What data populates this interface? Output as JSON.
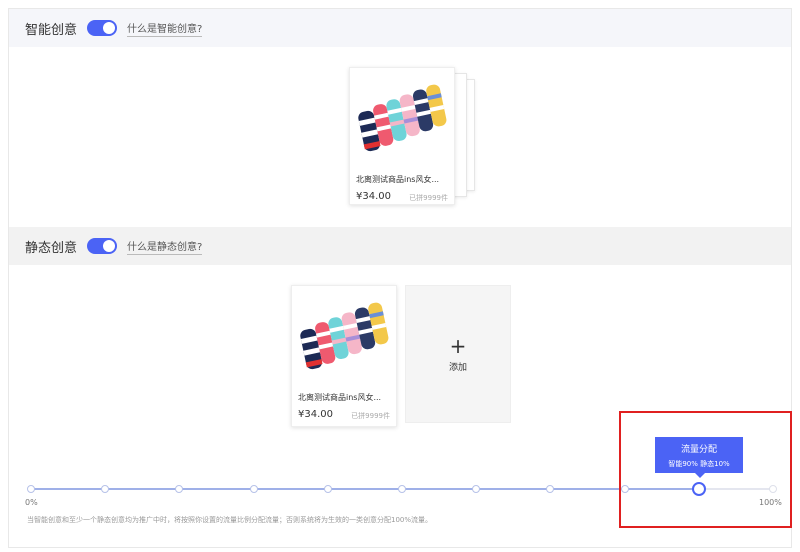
{
  "smart_section": {
    "title": "智能创意",
    "toggle_on": true,
    "help_link": "什么是智能创意?"
  },
  "static_section": {
    "title": "静态创意",
    "toggle_on": true,
    "help_link": "什么是静态创意?",
    "add_label": "添加",
    "add_icon": "+"
  },
  "product": {
    "title": "北离测试商品ins风女...",
    "price": "¥34.00",
    "sold": "已拼9999件"
  },
  "traffic": {
    "tooltip_title": "流量分配",
    "tooltip_detail": "智能90% 静态10%",
    "min_label": "0%",
    "max_label": "100%",
    "smart_percent": 90,
    "hint": "当智能创意和至少一个静态创意均为推广中时，将按照你设置的流量比例分配流量；否则系统将为生效的一类创意分配100%流量。"
  },
  "colors": {
    "accent": "#4b63f5",
    "highlight": "#e02020"
  }
}
